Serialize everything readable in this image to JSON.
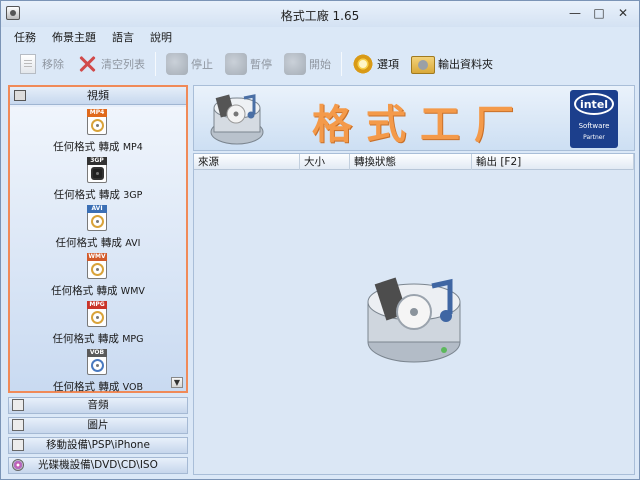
{
  "window": {
    "title": "格式工廠 1.65",
    "min_label": "—",
    "max_label": "□",
    "close_label": "✕"
  },
  "menu": [
    "任務",
    "佈景主題",
    "語言",
    "說明"
  ],
  "toolbar": {
    "remove": "移除",
    "clear": "清空列表",
    "stop": "停止",
    "pause": "暫停",
    "start": "開始",
    "options": "選項",
    "output_folder": "輸出資料夾"
  },
  "sidebar": {
    "video_header": "視頻",
    "items": [
      {
        "badge": "MP4",
        "badge_color": "#e0691c",
        "label": "任何格式 轉成",
        "fmt": "MP4"
      },
      {
        "badge": "3GP",
        "badge_color": "#333333",
        "label": "任何格式 轉成",
        "fmt": "3GP"
      },
      {
        "badge": "AVI",
        "badge_color": "#3b6fb5",
        "label": "任何格式 轉成",
        "fmt": "AVI"
      },
      {
        "badge": "WMV",
        "badge_color": "#d25a2a",
        "label": "任何格式 轉成",
        "fmt": "WMV"
      },
      {
        "badge": "MPG",
        "badge_color": "#c9342a",
        "label": "任何格式 轉成",
        "fmt": "MPG"
      },
      {
        "badge": "VOB",
        "badge_color": "#5a5a5a",
        "label": "任何格式 轉成",
        "fmt": "VOB"
      }
    ],
    "audio": "音頻",
    "picture": "圖片",
    "mobile": "移動設備\\PSP\\iPhone",
    "optical": "光碟機設備\\DVD\\CD\\ISO"
  },
  "banner": {
    "brand": "格式工厂",
    "intel_word": "intel",
    "intel_software": "Software",
    "intel_partner": "Partner"
  },
  "table": {
    "columns": [
      "來源",
      "大小",
      "轉換狀態",
      "輸出 [F2]"
    ]
  }
}
